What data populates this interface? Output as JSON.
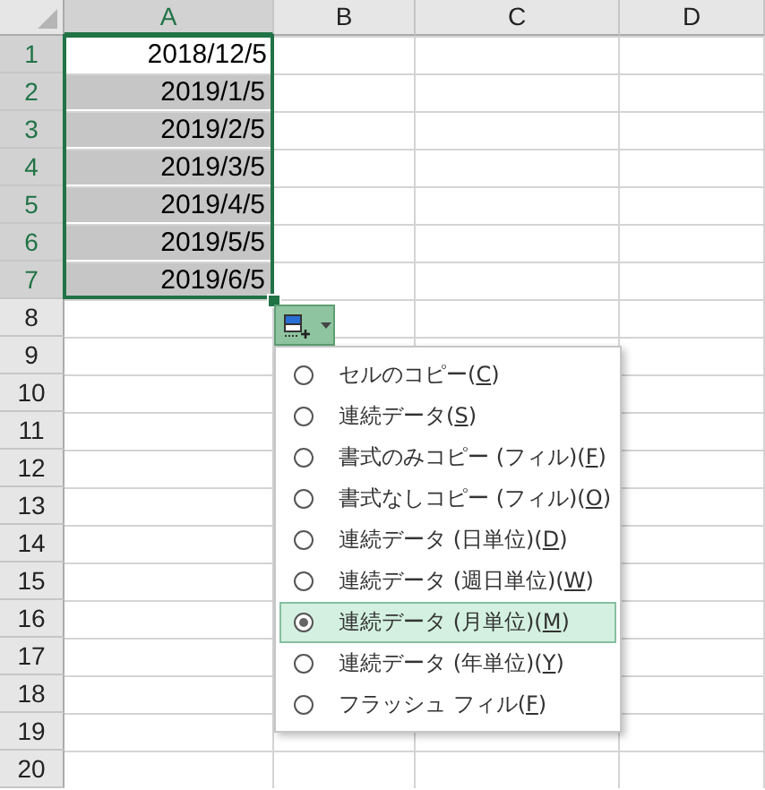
{
  "columns": [
    {
      "label": "A",
      "selected": true
    },
    {
      "label": "B",
      "selected": false
    },
    {
      "label": "C",
      "selected": false
    },
    {
      "label": "D",
      "selected": false
    }
  ],
  "rows": [
    {
      "number": "1",
      "highlighted": true,
      "value": "2018/12/5",
      "selected": false
    },
    {
      "number": "2",
      "highlighted": true,
      "value": "2019/1/5",
      "selected": true
    },
    {
      "number": "3",
      "highlighted": true,
      "value": "2019/2/5",
      "selected": true
    },
    {
      "number": "4",
      "highlighted": true,
      "value": "2019/3/5",
      "selected": true
    },
    {
      "number": "5",
      "highlighted": true,
      "value": "2019/4/5",
      "selected": true
    },
    {
      "number": "6",
      "highlighted": true,
      "value": "2019/5/5",
      "selected": true
    },
    {
      "number": "7",
      "highlighted": true,
      "value": "2019/6/5",
      "selected": true
    },
    {
      "number": "8",
      "highlighted": false
    },
    {
      "number": "9",
      "highlighted": false
    },
    {
      "number": "10",
      "highlighted": false
    },
    {
      "number": "11",
      "highlighted": false
    },
    {
      "number": "12",
      "highlighted": false
    },
    {
      "number": "13",
      "highlighted": false
    },
    {
      "number": "14",
      "highlighted": false
    },
    {
      "number": "15",
      "highlighted": false
    },
    {
      "number": "16",
      "highlighted": false
    },
    {
      "number": "17",
      "highlighted": false
    },
    {
      "number": "18",
      "highlighted": false
    },
    {
      "number": "19",
      "highlighted": false
    },
    {
      "number": "20",
      "highlighted": false
    }
  ],
  "fill_options": {
    "items": [
      {
        "text": "セルのコピー(",
        "key": "C",
        "suffix": ")",
        "selected": false
      },
      {
        "text": "連続データ(",
        "key": "S",
        "suffix": ")",
        "selected": false
      },
      {
        "text": "書式のみコピー (フィル)(",
        "key": "F",
        "suffix": ")",
        "selected": false
      },
      {
        "text": "書式なしコピー (フィル)(",
        "key": "O",
        "suffix": ")",
        "selected": false
      },
      {
        "text": "連続データ (日単位)(",
        "key": "D",
        "suffix": ")",
        "selected": false
      },
      {
        "text": "連続データ (週日単位)(",
        "key": "W",
        "suffix": ")",
        "selected": false
      },
      {
        "text": "連続データ (月単位)(",
        "key": "M",
        "suffix": ")",
        "selected": true
      },
      {
        "text": "連続データ (年単位)(",
        "key": "Y",
        "suffix": ")",
        "selected": false
      },
      {
        "text": "フラッシュ フィル(",
        "key": "F",
        "suffix": ")",
        "selected": false
      }
    ]
  }
}
